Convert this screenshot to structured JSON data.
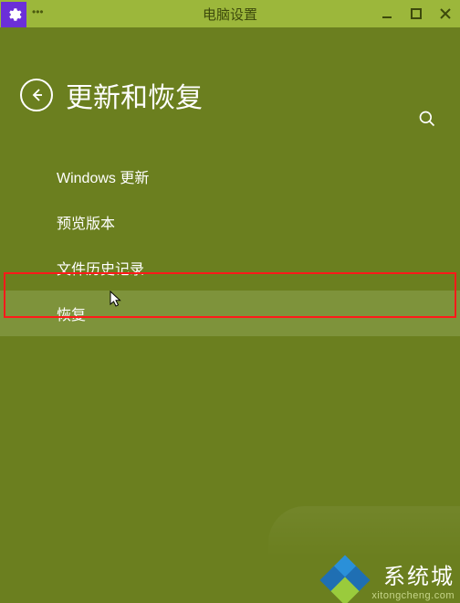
{
  "titlebar": {
    "title": "电脑设置"
  },
  "page": {
    "title": "更新和恢复"
  },
  "menu": {
    "items": [
      {
        "label": "Windows 更新"
      },
      {
        "label": "预览版本"
      },
      {
        "label": "文件历史记录"
      },
      {
        "label": "恢复"
      }
    ],
    "selected_index": 3
  },
  "watermark": {
    "brand": "系统城",
    "url": "xitongcheng.com"
  }
}
